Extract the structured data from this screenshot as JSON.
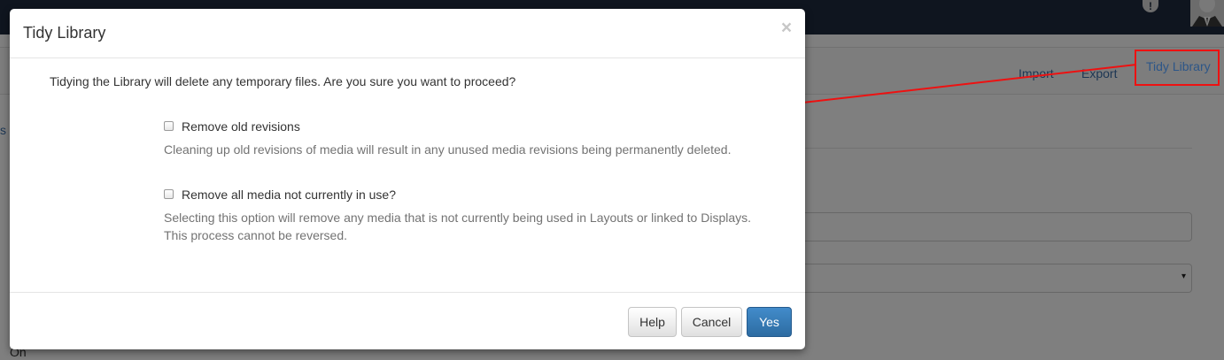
{
  "background": {
    "alert_glyph": "!",
    "tabs": {
      "import": "Import",
      "export": "Export",
      "tidy_library": "Tidy Library"
    },
    "link_fragment": "s",
    "on_text": "On",
    "select_caret": "▾"
  },
  "modal": {
    "title": "Tidy Library",
    "close_glyph": "×",
    "intro": "Tidying the Library will delete any temporary files. Are you sure you want to proceed?",
    "options": [
      {
        "label": "Remove old revisions",
        "help": "Cleaning up old revisions of media will result in any unused media revisions being permanently deleted.",
        "checked": false
      },
      {
        "label": "Remove all media not currently in use?",
        "help_line1": "Selecting this option will remove any media that is not currently being used in Layouts or linked to Displays.",
        "help_line2": "This process cannot be reversed.",
        "checked": false
      }
    ],
    "buttons": {
      "help": "Help",
      "cancel": "Cancel",
      "yes": "Yes"
    }
  },
  "colors": {
    "topbar": "#1f2b3e",
    "link": "#3c6fa8",
    "primary_button": "#337ab7",
    "annotation": "#ee1111"
  },
  "icons": {
    "alert": "exclamation-circle-icon",
    "close": "close-icon",
    "dropdown": "caret-down-icon"
  }
}
